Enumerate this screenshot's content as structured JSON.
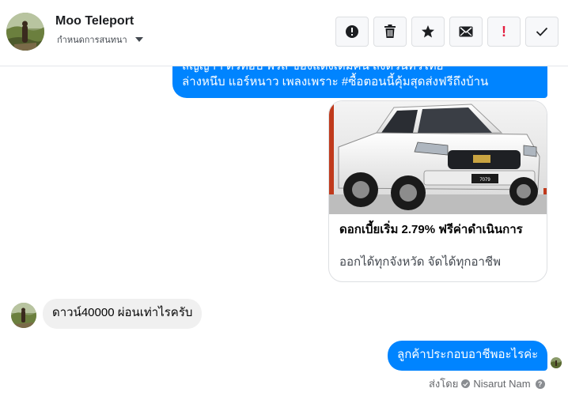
{
  "header": {
    "contact_name": "Moo Teleport",
    "assign_label": "กำหนดการสนทนา",
    "actions": [
      {
        "name": "spam-button",
        "icon": "alert-circle-icon"
      },
      {
        "name": "delete-button",
        "icon": "trash-icon"
      },
      {
        "name": "star-button",
        "icon": "star-icon"
      },
      {
        "name": "mark-unread-button",
        "icon": "envelope-icon"
      },
      {
        "name": "follow-up-button",
        "icon": "exclamation-icon",
        "label": "!"
      },
      {
        "name": "done-button",
        "icon": "check-icon"
      }
    ]
  },
  "messages": {
    "outgoing_top": {
      "line1": "สัญญาฯ ตัวท็อป ฟรีส์ ของแต่งเต็มคัน ส่งด่วนทั่วไทย",
      "line2": "ล่างหนึบ แอร์หนาว เพลงเพราะ #ซื้อตอนนี้คุ้มสุดส่งฟรีถึงบ้าน"
    },
    "card": {
      "title": "ดอกเบี้ยเริ่ม 2.79% ฟรีค่าดำเนินการ",
      "description": "ออกได้ทุกจังหวัด จัดได้ทุกอาชีพ",
      "plate_text": "7079"
    },
    "incoming": "ดาวน์40000 ผ่อนเท่าไรครับ",
    "outgoing_last": "ลูกค้าประกอบอาชีพอะไรค่ะ",
    "sent_by_label": "ส่งโดย",
    "sent_by_name": "Nisarut Nam"
  },
  "colors": {
    "accent": "#0084ff",
    "incoming_bubble": "#f0f0f0",
    "follow_up": "#e41e3f"
  }
}
